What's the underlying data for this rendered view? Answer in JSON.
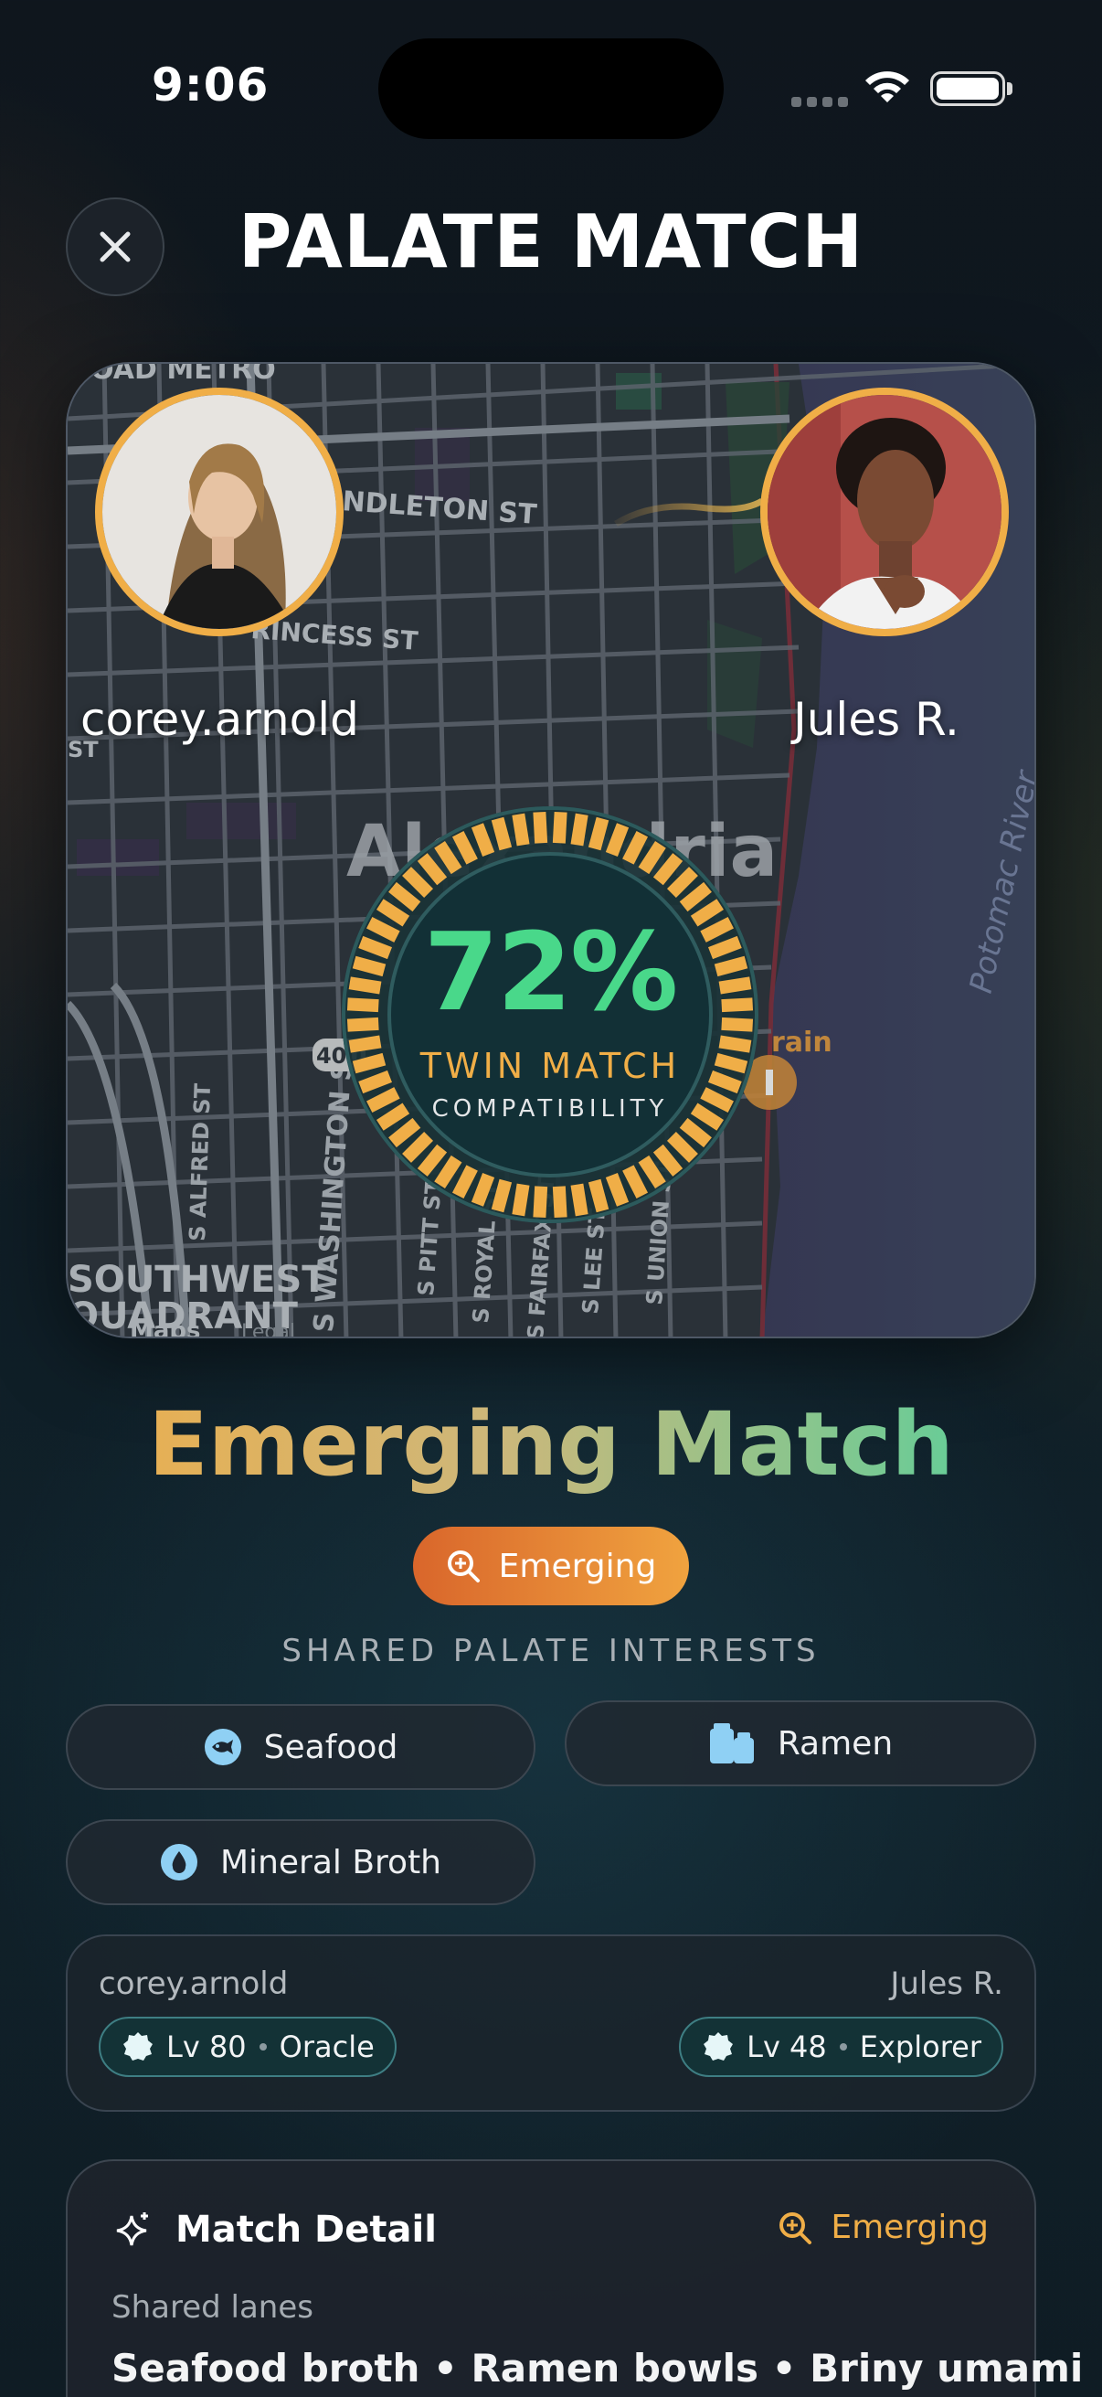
{
  "status_bar": {
    "time": "9:06"
  },
  "header": {
    "title": "PALATE MATCH",
    "close_icon": "close-icon"
  },
  "map": {
    "labels": {
      "road_metro": "ROAD METRO",
      "pendleton": "NDLETON ST",
      "princess": "RINCESS ST",
      "city": "Alexandria",
      "river": "Potomac River",
      "route": "400",
      "alfred": "S ALFRED ST",
      "washington": "S WASHINGTON ST",
      "pitt": "S PITT ST",
      "royal": "S ROYAL ST",
      "fairfax": "S FAIRFAX ST",
      "lee": "S LEE ST",
      "union": "S UNION ST",
      "southwest": "SOUTHWEST",
      "quadrant": "QUADRANT",
      "maps": "Maps",
      "legal": "Legal",
      "rain": "rain",
      "st": "ST"
    }
  },
  "users": {
    "left": {
      "name": "corey.arnold",
      "level": "Lv 80",
      "rank": "Oracle"
    },
    "right": {
      "name": "Jules R.",
      "level": "Lv 48",
      "rank": "Explorer"
    }
  },
  "match": {
    "percent": "72%",
    "percent_value": 72,
    "kind": "TWIN MATCH",
    "sub": "COMPATIBILITY",
    "tier_title": "Emerging Match",
    "tier_badge": "Emerging"
  },
  "shared": {
    "label": "SHARED PALATE INTERESTS",
    "chips": [
      {
        "label": "Seafood",
        "icon": "fish-icon"
      },
      {
        "label": "Ramen",
        "icon": "ramen-icon"
      },
      {
        "label": "Mineral Broth",
        "icon": "water-drop-icon"
      }
    ]
  },
  "detail": {
    "title": "Match Detail",
    "status": "Emerging",
    "lanes_label": "Shared lanes",
    "lanes_value": "Seafood broth • Ramen bowls • Briny umami"
  },
  "colors": {
    "accent_orange": "#f0ae47",
    "accent_green": "#49d88a",
    "pill_teal": "#133236"
  }
}
